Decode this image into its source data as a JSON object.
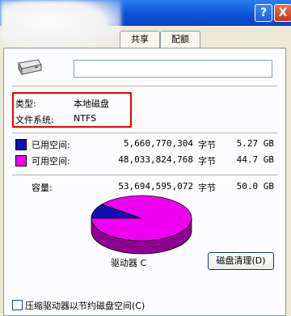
{
  "window": {
    "help_glyph": "?",
    "close_glyph": "X"
  },
  "tabs": [
    {
      "label": "共享"
    },
    {
      "label": "配额"
    }
  ],
  "info": {
    "type_label": "类型:",
    "type_value": "本地磁盘",
    "fs_label": "文件系统:",
    "fs_value": "NTFS"
  },
  "space": {
    "used": {
      "label": "已用空间:",
      "bytes": "5,660,770,304",
      "unit": "字节",
      "size": "5.27 GB",
      "color": "#1010b0"
    },
    "free": {
      "label": "可用空间:",
      "bytes": "48,033,824,768",
      "unit": "字节",
      "size": "44.7 GB",
      "color": "#f000f0"
    },
    "capacity": {
      "label": "容量:",
      "bytes": "53,694,595,072",
      "unit": "字节",
      "size": "50.0 GB"
    }
  },
  "chart_data": {
    "type": "pie",
    "categories": [
      "已用空间",
      "可用空间"
    ],
    "values": [
      5.27,
      44.7
    ]
  },
  "drive_label": "驱动器 C",
  "cleanup_button": "磁盘清理(D)",
  "compress_checkbox": {
    "label": "压缩驱动器以节约磁盘空间(C)",
    "checked": false
  }
}
